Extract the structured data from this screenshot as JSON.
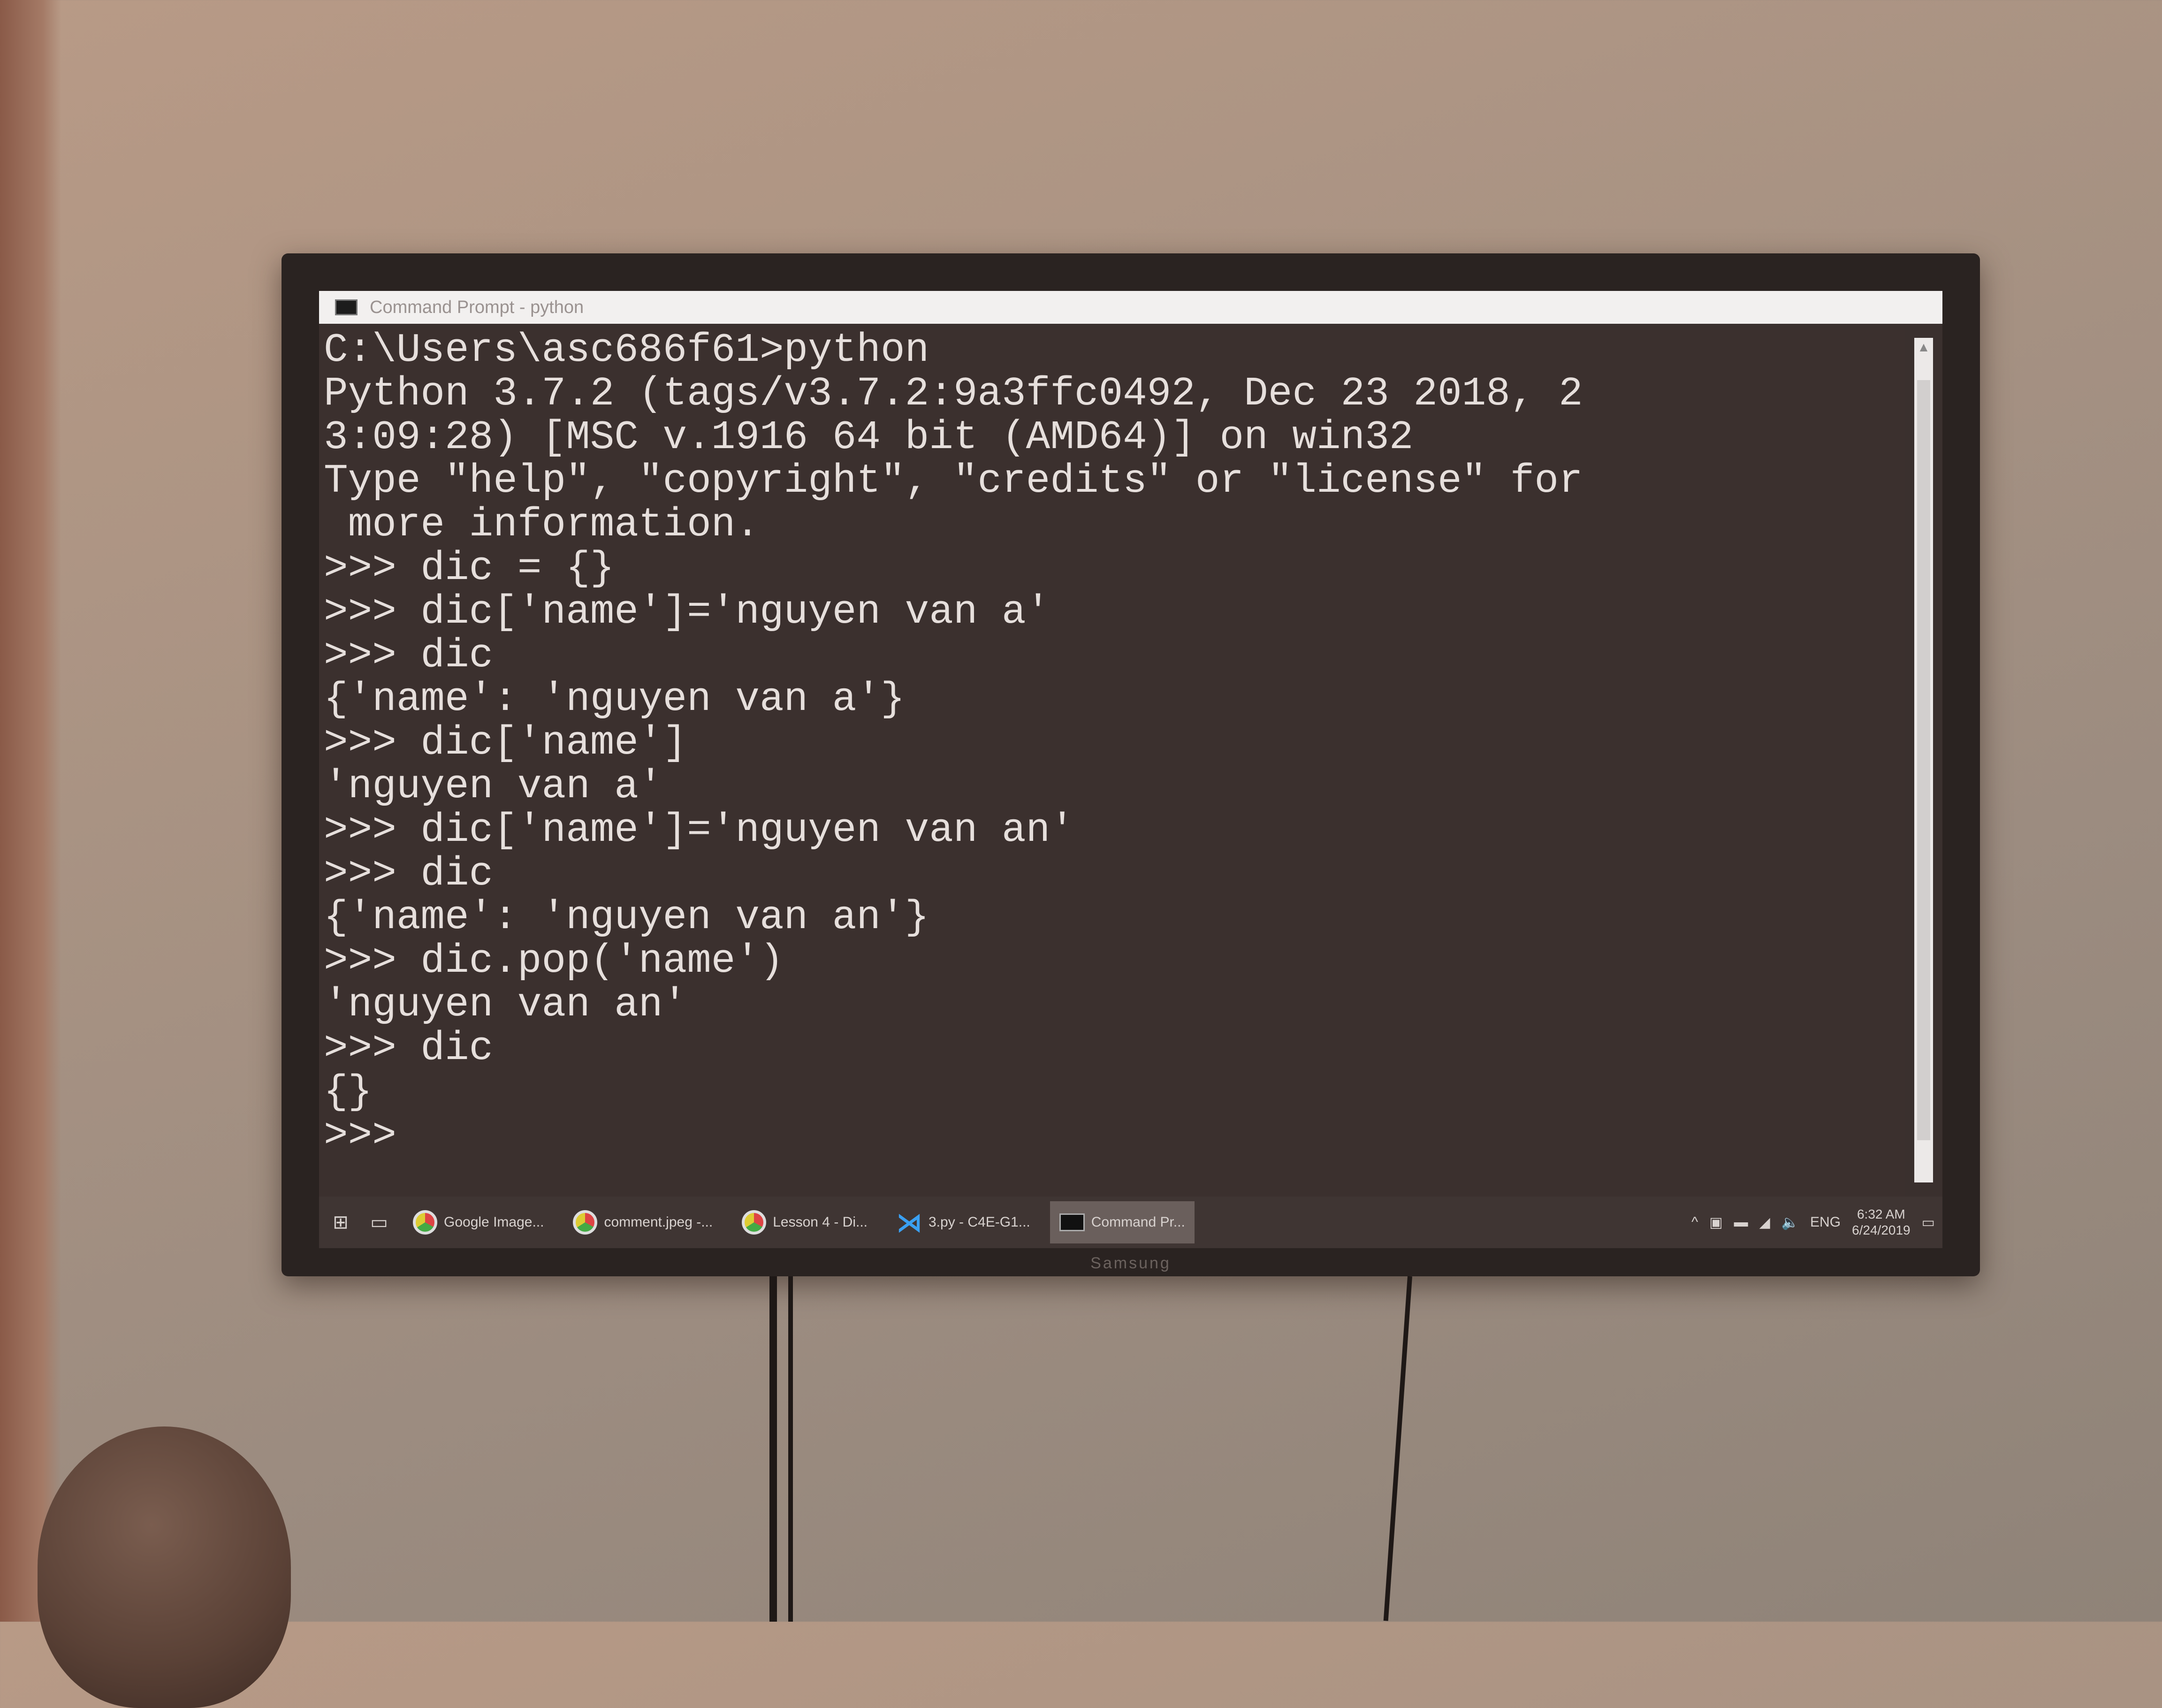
{
  "window": {
    "title": "Command Prompt - python"
  },
  "console": {
    "lines": [
      "C:\\Users\\asc686f61>python",
      "Python 3.7.2 (tags/v3.7.2:9a3ffc0492, Dec 23 2018, 2",
      "3:09:28) [MSC v.1916 64 bit (AMD64)] on win32",
      "Type \"help\", \"copyright\", \"credits\" or \"license\" for",
      " more information.",
      ">>> dic = {}",
      ">>> dic['name']='nguyen van a'",
      ">>> dic",
      "{'name': 'nguyen van a'}",
      ">>> dic['name']",
      "'nguyen van a'",
      ">>> dic['name']='nguyen van an'",
      ">>> dic",
      "{'name': 'nguyen van an'}",
      ">>> dic.pop('name')",
      "'nguyen van an'",
      ">>> dic",
      "{}",
      ">>>"
    ]
  },
  "taskbar": {
    "apps": [
      {
        "label": "Google Image...",
        "icon": "chrome-icon"
      },
      {
        "label": "comment.jpeg -...",
        "icon": "chrome-icon"
      },
      {
        "label": "Lesson 4 - Di...",
        "icon": "chrome-icon"
      },
      {
        "label": "3.py - C4E-G1...",
        "icon": "vscode-icon"
      },
      {
        "label": "Command Pr...",
        "icon": "cmd-icon",
        "active": true
      }
    ],
    "language": "ENG",
    "time": "6:32 AM",
    "date": "6/24/2019"
  },
  "tv": {
    "brand": "Samsung"
  },
  "colors": {
    "console_bg": "#3b302e",
    "console_text": "#e6dfdc",
    "taskbar_bg": "#3f3533",
    "titlebar_bg": "#f2f0ef"
  }
}
